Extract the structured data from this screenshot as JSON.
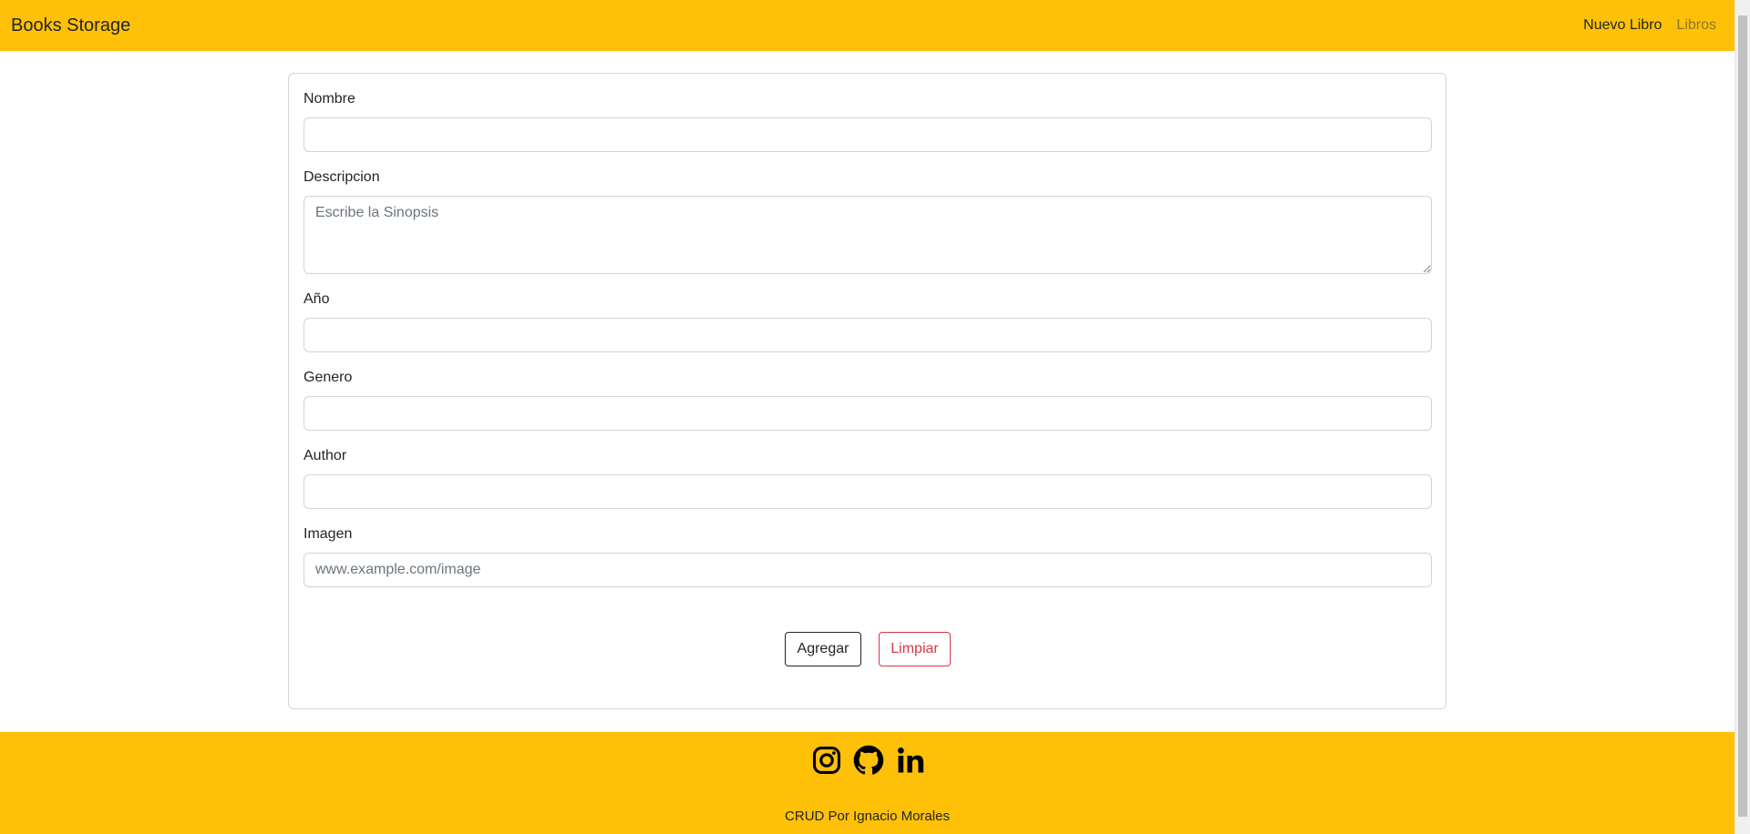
{
  "navbar": {
    "brand": "Books Storage",
    "links": [
      {
        "label": "Nuevo Libro",
        "active": true
      },
      {
        "label": "Libros",
        "active": false
      }
    ]
  },
  "form": {
    "fields": {
      "nombre": {
        "label": "Nombre",
        "value": "",
        "placeholder": ""
      },
      "descripcion": {
        "label": "Descripcion",
        "value": "",
        "placeholder": "Escribe la Sinopsis"
      },
      "anio": {
        "label": "Año",
        "value": "",
        "placeholder": ""
      },
      "genero": {
        "label": "Genero",
        "value": "",
        "placeholder": ""
      },
      "author": {
        "label": "Author",
        "value": "",
        "placeholder": ""
      },
      "imagen": {
        "label": "Imagen",
        "value": "",
        "placeholder": "www.example.com/image"
      }
    },
    "buttons": {
      "submit_label": "Agregar",
      "clear_label": "Limpiar"
    }
  },
  "footer": {
    "icons": [
      "instagram-icon",
      "github-icon",
      "linkedin-icon"
    ],
    "credit": "CRUD Por Ignacio Morales"
  },
  "colors": {
    "accent": "#ffc107",
    "danger": "#dc3545",
    "dark": "#212529"
  }
}
